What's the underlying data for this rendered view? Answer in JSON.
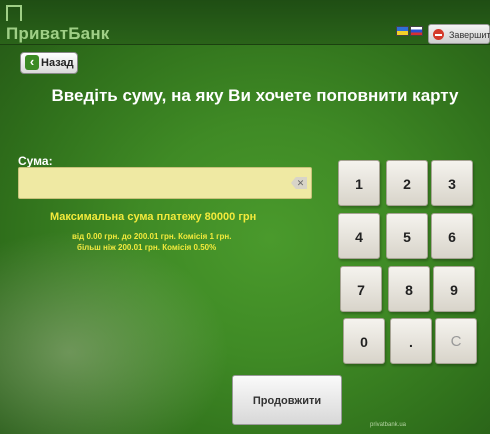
{
  "header": {
    "logo_text": "ПриватБанк",
    "finish_label": "Завершити"
  },
  "nav": {
    "back_label": "Назад"
  },
  "main": {
    "title": "Введіть суму, на яку Ви хочете поповнити карту",
    "amount_label": "Сума:",
    "amount_value": "",
    "max_sum_text": "Максимальна сума платежу 80000 грн",
    "fee_line_1": "від 0.00 грн. до 200.01 грн. Комісія 1 грн.",
    "fee_line_2": "більш ніж 200.01 грн. Комісія 0.50%"
  },
  "keypad": {
    "keys": [
      "1",
      "2",
      "3",
      "4",
      "5",
      "6",
      "7",
      "8",
      "9",
      "0",
      ".",
      "C"
    ]
  },
  "footer": {
    "continue_label": "Продовжити",
    "bottom_text": "privatbank.ua"
  },
  "colors": {
    "background": "#3f8a25",
    "accent_text": "#f2ea3c",
    "input_fill": "#efe9a3"
  }
}
